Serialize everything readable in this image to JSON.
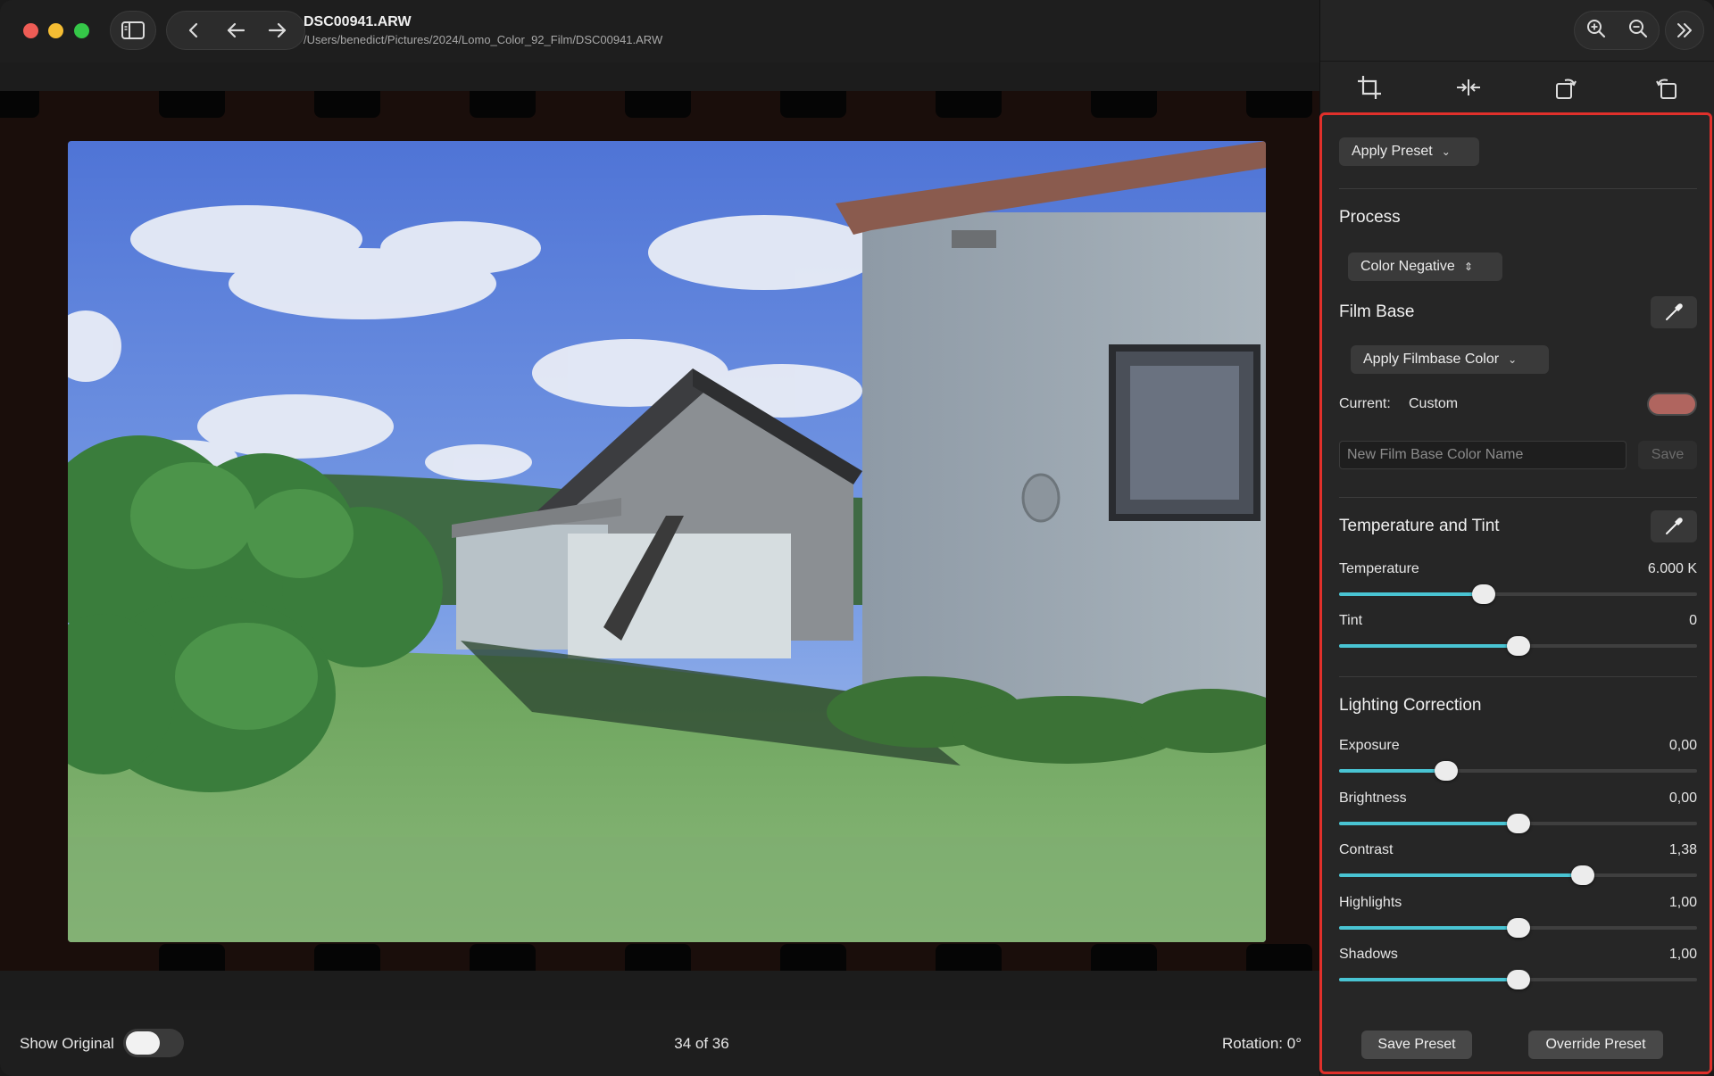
{
  "window": {
    "file_name": "DSC00941.ARW",
    "file_path": "/Users/benedict/Pictures/2024/Lomo_Color_92_Film/DSC00941.ARW"
  },
  "toolbar": {
    "icons": [
      "sidebar-toggle-icon",
      "chevron-left-icon",
      "arrow-left-icon",
      "arrow-right-icon",
      "zoom-in-icon",
      "zoom-out-icon",
      "double-chevron-right-icon"
    ],
    "tools": [
      "crop-icon",
      "flip-icon",
      "rotate-right-icon",
      "rotate-left-icon"
    ]
  },
  "bottom_bar": {
    "show_original_label": "Show Original",
    "show_original_on": false,
    "counter": "34 of 36",
    "rotation": "Rotation: 0°"
  },
  "panel": {
    "apply_preset": "Apply Preset",
    "process": {
      "title": "Process",
      "selected": "Color Negative"
    },
    "film_base": {
      "title": "Film Base",
      "apply_button": "Apply Filmbase Color",
      "current_label": "Current:",
      "current_value": "Custom",
      "swatch_color": "#b0655f",
      "name_placeholder": "New Film Base Color Name",
      "save_label": "Save"
    },
    "temp_tint": {
      "title": "Temperature and Tint",
      "sliders": [
        {
          "label": "Temperature",
          "value": "6.000 K",
          "fraction": 0.405
        },
        {
          "label": "Tint",
          "value": "0",
          "fraction": 0.5
        }
      ]
    },
    "lighting": {
      "title": "Lighting Correction",
      "sliders": [
        {
          "label": "Exposure",
          "value": "0,00",
          "fraction": 0.3
        },
        {
          "label": "Brightness",
          "value": "0,00",
          "fraction": 0.5
        },
        {
          "label": "Contrast",
          "value": "1,38",
          "fraction": 0.68
        },
        {
          "label": "Highlights",
          "value": "1,00",
          "fraction": 0.5
        },
        {
          "label": "Shadows",
          "value": "1,00",
          "fraction": 0.5
        }
      ]
    },
    "save_preset": "Save Preset",
    "override_preset": "Override Preset"
  },
  "colors": {
    "accent": "#49c4d3",
    "highlight_border": "#e0302b"
  }
}
